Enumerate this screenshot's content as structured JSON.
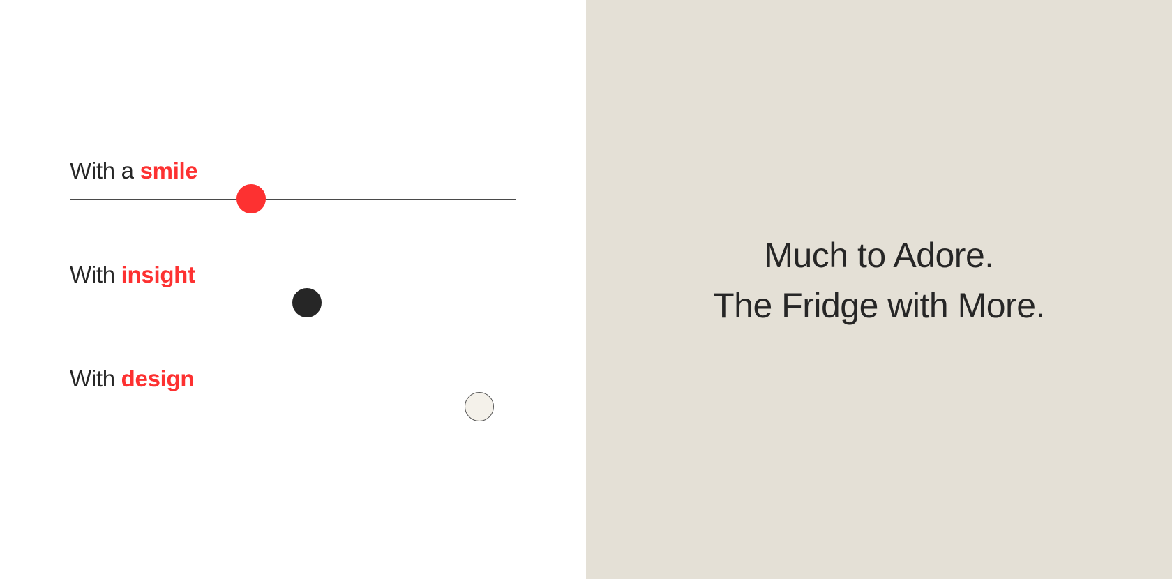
{
  "sliders": [
    {
      "prefix": "With a ",
      "emphasis": "smile",
      "value": 0.406,
      "thumb_color": "#fd3131",
      "thumb_border": "#fd3131"
    },
    {
      "prefix": "With ",
      "emphasis": "insight",
      "value": 0.531,
      "thumb_color": "#262626",
      "thumb_border": "#262626"
    },
    {
      "prefix": "With ",
      "emphasis": "design",
      "value": 0.917,
      "thumb_color": "#f4f1ea",
      "thumb_border": "#555555"
    }
  ],
  "emphasis_color": "#fd3131",
  "headline": {
    "line1": "Much to Adore.",
    "line2": "The Fridge with More."
  },
  "colors": {
    "right_panel_bg": "#e4e0d6",
    "text": "#262626"
  }
}
